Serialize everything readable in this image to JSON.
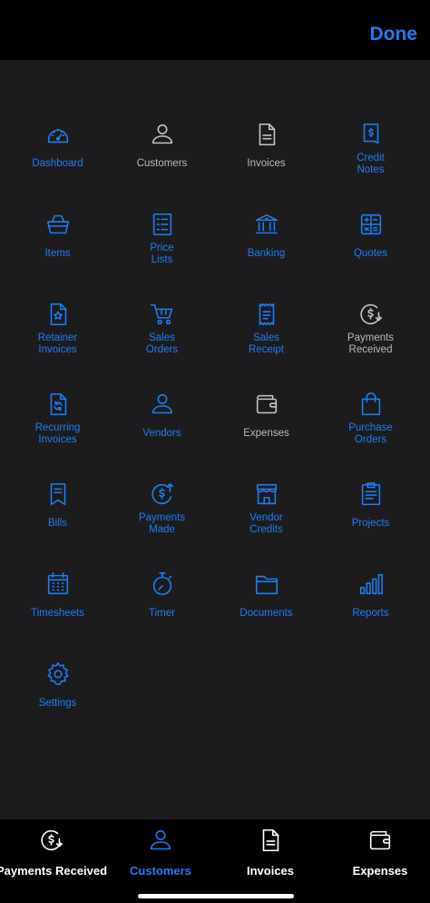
{
  "header": {
    "done_label": "Done"
  },
  "menu": {
    "items": [
      {
        "label": "Dashboard",
        "icon": "dashboard-icon",
        "active": true
      },
      {
        "label": "Customers",
        "icon": "customer-icon",
        "active": false
      },
      {
        "label": "Invoices",
        "icon": "invoice-icon",
        "active": false
      },
      {
        "label": "Credit\nNotes",
        "icon": "credit-notes-icon",
        "active": true
      },
      {
        "label": "Items",
        "icon": "basket-icon",
        "active": true
      },
      {
        "label": "Price\nLists",
        "icon": "price-list-icon",
        "active": true
      },
      {
        "label": "Banking",
        "icon": "bank-icon",
        "active": true
      },
      {
        "label": "Quotes",
        "icon": "calculator-icon",
        "active": true
      },
      {
        "label": "Retainer\nInvoices",
        "icon": "retainer-invoice-icon",
        "active": true
      },
      {
        "label": "Sales\nOrders",
        "icon": "cart-icon",
        "active": true
      },
      {
        "label": "Sales\nReceipt",
        "icon": "receipt-icon",
        "active": true
      },
      {
        "label": "Payments\nReceived",
        "icon": "payment-received-icon",
        "active": false
      },
      {
        "label": "Recurring\nInvoices",
        "icon": "recurring-invoice-icon",
        "active": true
      },
      {
        "label": "Vendors",
        "icon": "vendor-icon",
        "active": true
      },
      {
        "label": "Expenses",
        "icon": "wallet-icon",
        "active": false
      },
      {
        "label": "Purchase\nOrders",
        "icon": "shopping-bag-icon",
        "active": true
      },
      {
        "label": "Bills",
        "icon": "bill-icon",
        "active": true
      },
      {
        "label": "Payments\nMade",
        "icon": "payment-made-icon",
        "active": true
      },
      {
        "label": "Vendor\nCredits",
        "icon": "store-icon",
        "active": true
      },
      {
        "label": "Projects",
        "icon": "clipboard-icon",
        "active": true
      },
      {
        "label": "Timesheets",
        "icon": "calendar-icon",
        "active": true
      },
      {
        "label": "Timer",
        "icon": "stopwatch-icon",
        "active": true
      },
      {
        "label": "Documents",
        "icon": "folder-icon",
        "active": true
      },
      {
        "label": "Reports",
        "icon": "bar-chart-icon",
        "active": true
      },
      {
        "label": "Settings",
        "icon": "gear-icon",
        "active": true
      }
    ]
  },
  "tabbar": {
    "tabs": [
      {
        "label": "Payments Received",
        "icon": "payment-received-icon",
        "active": false
      },
      {
        "label": "Customers",
        "icon": "customer-icon",
        "active": true
      },
      {
        "label": "Invoices",
        "icon": "invoice-icon",
        "active": false
      },
      {
        "label": "Expenses",
        "icon": "wallet-icon",
        "active": false
      }
    ]
  },
  "colors": {
    "accent": "#1e7cf0",
    "panel": "#1c1c1e",
    "inactive": "#b9b9bd"
  }
}
